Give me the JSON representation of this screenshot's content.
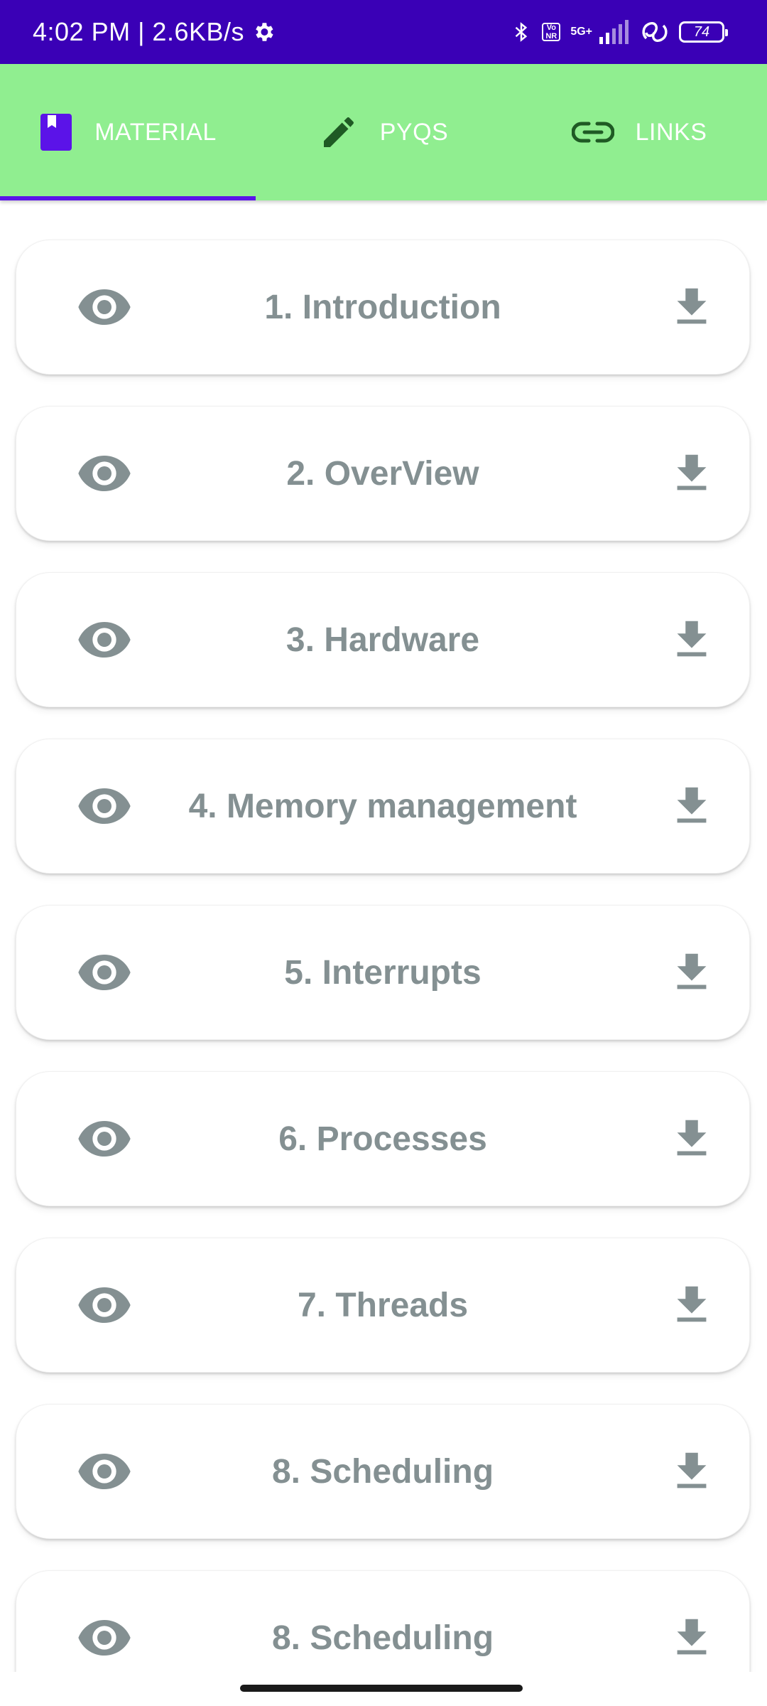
{
  "status_bar": {
    "time_speed": "4:02 PM | 2.6KB/s",
    "vonr": "Vo NR",
    "network": "5G+",
    "battery": "74",
    "background_color": "#3a00b6"
  },
  "tabs": [
    {
      "label": "MATERIAL",
      "icon": "book-icon",
      "selected": true
    },
    {
      "label": "PYQS",
      "icon": "pencil-icon",
      "selected": false
    },
    {
      "label": "LINKS",
      "icon": "link-icon",
      "selected": false
    }
  ],
  "tab_bar_color": "#90ee90",
  "accent_color": "#5b13e8",
  "items": [
    {
      "title": "1. Introduction"
    },
    {
      "title": "2. OverView"
    },
    {
      "title": "3. Hardware"
    },
    {
      "title": "4. Memory management"
    },
    {
      "title": "5. Interrupts"
    },
    {
      "title": "6. Processes"
    },
    {
      "title": "7. Threads"
    },
    {
      "title": "8. Scheduling"
    },
    {
      "title": "8. Scheduling"
    }
  ]
}
